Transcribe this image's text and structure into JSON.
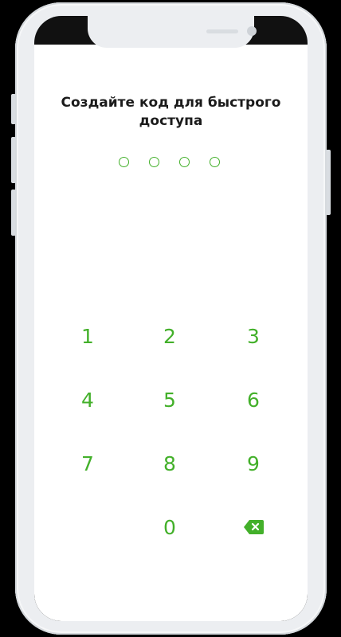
{
  "colors": {
    "accent": "#43b02a",
    "title_text": "#1b1b1b",
    "phone_frame": "#eceef1",
    "screen_bg": "#ffffff"
  },
  "pin_screen": {
    "title_line1": "Создайте код для быстрого",
    "title_line2": "доступа",
    "pin_length": 4,
    "pin_entered": 0
  },
  "keypad": {
    "k1": "1",
    "k2": "2",
    "k3": "3",
    "k4": "4",
    "k5": "5",
    "k6": "6",
    "k7": "7",
    "k8": "8",
    "k9": "9",
    "k0": "0",
    "backspace_icon": "backspace-icon"
  }
}
